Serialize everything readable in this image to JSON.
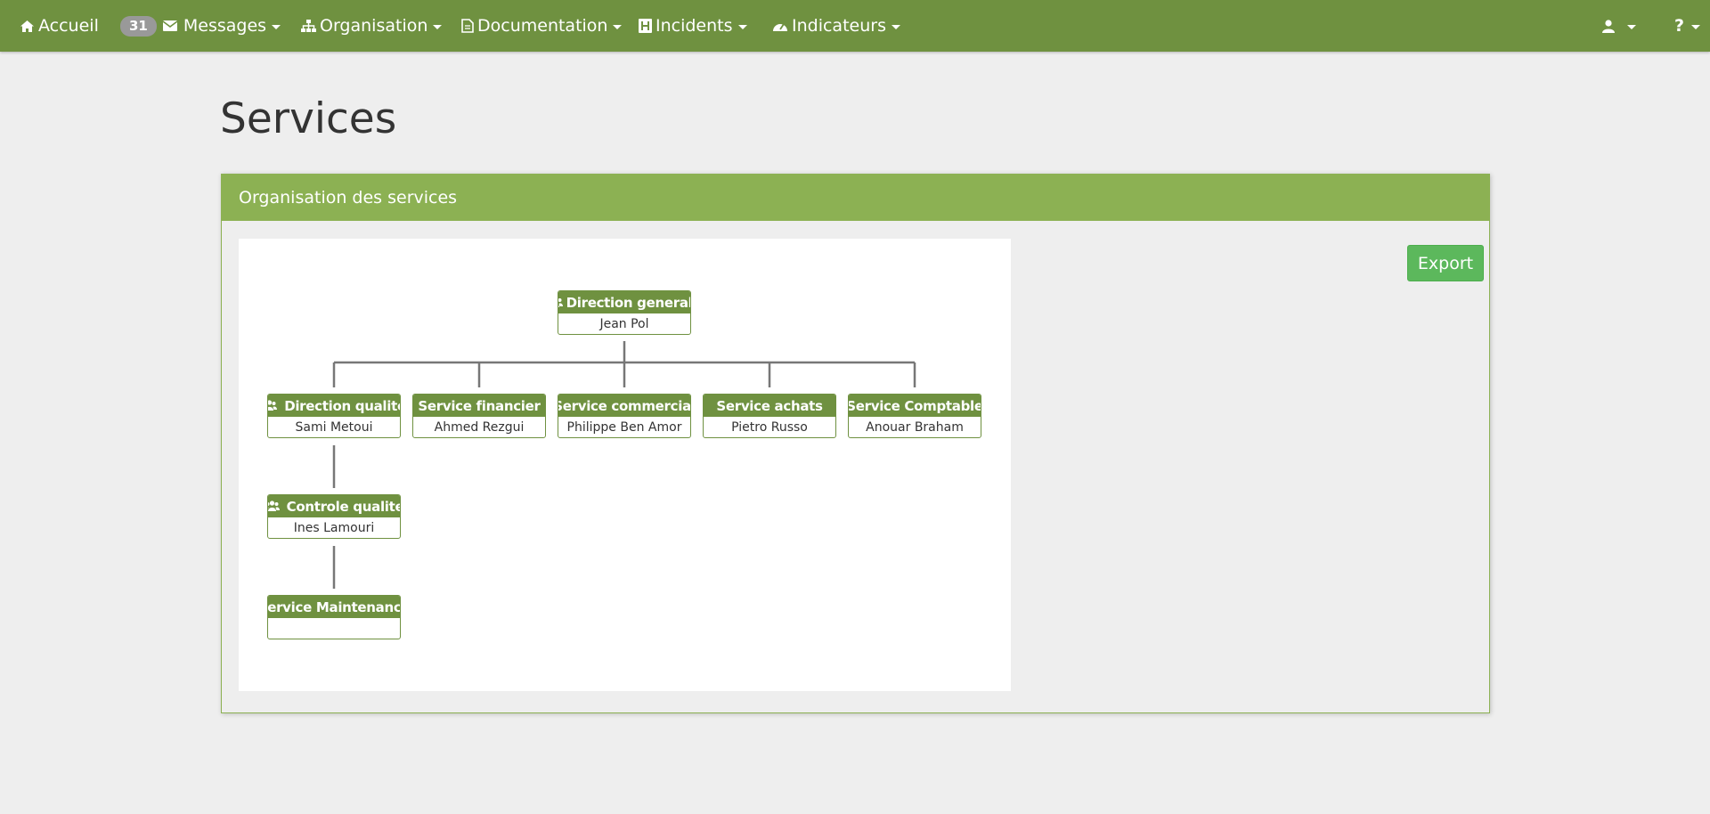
{
  "navbar": {
    "home_label": "Accueil",
    "messages_count": "31",
    "messages_label": "Messages",
    "organisation_label": "Organisation",
    "documentation_label": "Documentation",
    "incidents_label": "Incidents",
    "indicateurs_label": "Indicateurs",
    "user_icon": "user-icon",
    "help_label": "?"
  },
  "page": {
    "title": "Services"
  },
  "panel": {
    "heading": "Organisation des services",
    "export_label": "Export"
  },
  "org_chart": {
    "root": {
      "title": "Direction generale",
      "person": "Jean Pol",
      "icon": "group-icon"
    },
    "level1": [
      {
        "title": "Direction qualite",
        "person": "Sami Metoui",
        "icon": "group-icon"
      },
      {
        "title": "Service financier",
        "person": "Ahmed Rezgui",
        "icon": ""
      },
      {
        "title": "Service commercial",
        "person": "Philippe Ben Amor",
        "icon": ""
      },
      {
        "title": "Service achats",
        "person": "Pietro Russo",
        "icon": ""
      },
      {
        "title": "Service Comptable",
        "person": "Anouar Braham",
        "icon": ""
      }
    ],
    "level2": {
      "title": "Controle qualite",
      "person": "Ines Lamouri",
      "icon": "group-icon"
    },
    "level3": {
      "title": "Service Maintenance",
      "person": "",
      "icon": ""
    },
    "colors": {
      "node_header": "#6f9140",
      "connector": "#777777"
    }
  }
}
